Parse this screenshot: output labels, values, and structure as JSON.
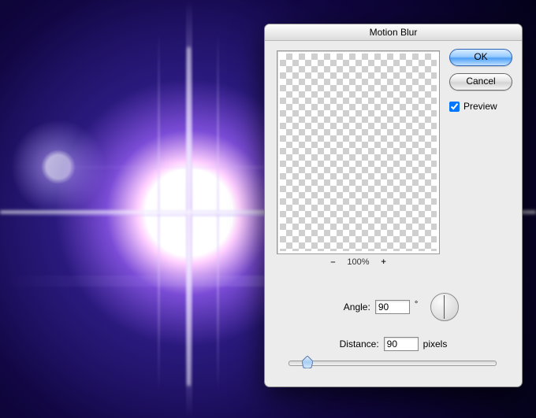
{
  "dialog": {
    "title": "Motion Blur",
    "ok_label": "OK",
    "cancel_label": "Cancel",
    "preview_label": "Preview",
    "preview_checked": true,
    "zoom": {
      "minus": "–",
      "plus": "+",
      "percent": "100%"
    },
    "angle": {
      "label": "Angle:",
      "value": "90",
      "unit": "°"
    },
    "distance": {
      "label": "Distance:",
      "value": "90",
      "unit": "pixels",
      "min": 1,
      "max": 999,
      "slider_percent": 9
    }
  }
}
